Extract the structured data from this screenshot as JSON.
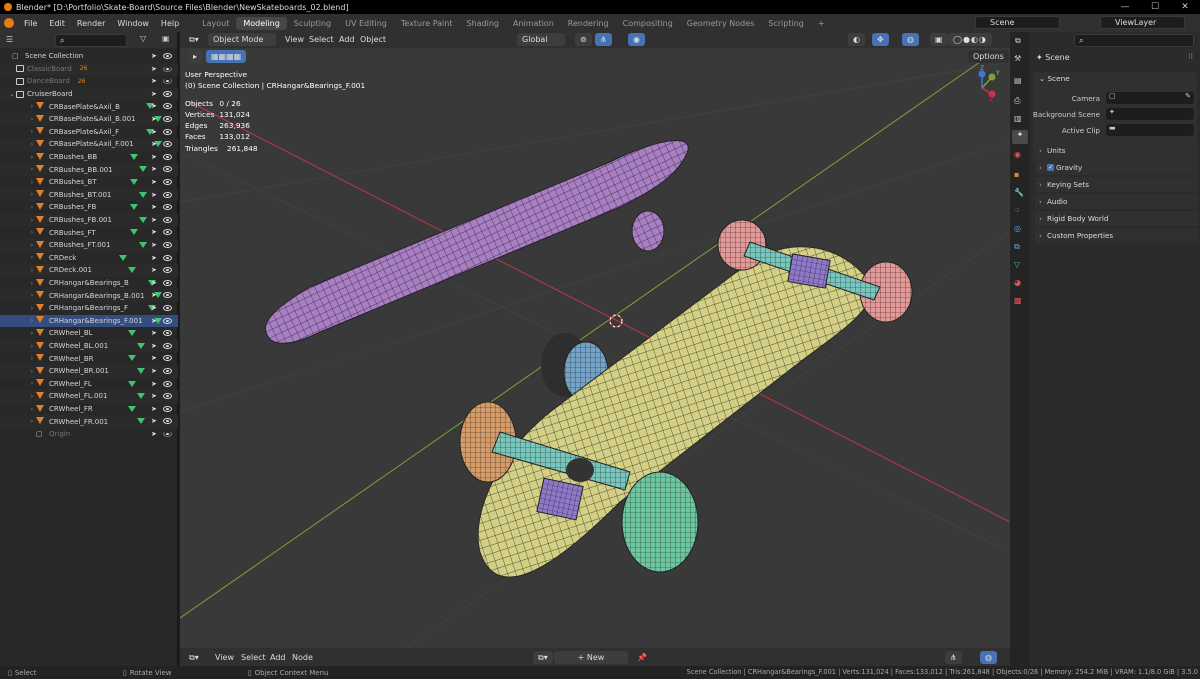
{
  "window": {
    "title": "Blender* [D:\\Portfolio\\Skate-Board\\Source Files\\Blender\\NewSkateboards_02.blend]",
    "min": "—",
    "max": "☐",
    "close": "✕"
  },
  "menus": [
    "File",
    "Edit",
    "Render",
    "Window",
    "Help"
  ],
  "workspaces": [
    "Layout",
    "Modeling",
    "Sculpting",
    "UV Editing",
    "Texture Paint",
    "Shading",
    "Animation",
    "Rendering",
    "Compositing",
    "Geometry Nodes",
    "Scripting",
    "+"
  ],
  "active_workspace": "Modeling",
  "scene_field": "Scene",
  "viewlayer_field": "ViewLayer",
  "outliner": {
    "root": "Scene Collection",
    "collections": [
      {
        "name": "ClassicBoard",
        "badge": "26",
        "dim": true
      },
      {
        "name": "DanceBoard",
        "badge": "26",
        "dim": true
      },
      {
        "name": "CruiserBoard",
        "dim": false
      }
    ],
    "objects": [
      "CRBasePlate&Axil_B",
      "CRBasePlate&Axil_B.001",
      "CRBasePlate&Axil_F",
      "CRBasePlate&Axil_F.001",
      "CRBushes_BB",
      "CRBushes_BB.001",
      "CRBushes_BT",
      "CRBushes_BT.001",
      "CRBushes_FB",
      "CRBushes_FB.001",
      "CRBushes_FT",
      "CRBushes_FT.001",
      "CRDeck",
      "CRDeck.001",
      "CRHangar&Bearings_B",
      "CRHangar&Bearings_B.001",
      "CRHangar&Bearings_F",
      "CRHangar&Bearings_F.001",
      "CRWheel_BL",
      "CRWheel_BL.001",
      "CRWheel_BR",
      "CRWheel_BR.001",
      "CRWheel_FL",
      "CRWheel_FL.001",
      "CRWheel_FR",
      "CRWheel_FR.001"
    ],
    "selected": "CRHangar&Bearings_F.001",
    "footer_item": "Origin"
  },
  "viewport": {
    "mode": "Object Mode",
    "menus": [
      "View",
      "Select",
      "Add",
      "Object"
    ],
    "orientation": "Global",
    "options": "Options",
    "perspective": "User Perspective",
    "context": "(0) Scene Collection | CRHangar&Bearings_F.001",
    "stats": [
      {
        "k": "Objects",
        "v": "0 / 26"
      },
      {
        "k": "Vertices",
        "v": "131,024"
      },
      {
        "k": "Edges",
        "v": "263,936"
      },
      {
        "k": "Faces",
        "v": "133,012"
      },
      {
        "k": "Triangles",
        "v": "261,848"
      }
    ],
    "gizmo": {
      "x": "X",
      "y": "Y",
      "z": "Z"
    },
    "footer_menus": [
      "View",
      "Select",
      "Add",
      "Node"
    ],
    "new_button": "New"
  },
  "properties": {
    "title": "Scene",
    "section": "Scene",
    "camera_label": "Camera",
    "bg_scene_label": "Background Scene",
    "active_clip_label": "Active Clip",
    "panels": [
      "Units",
      "Gravity",
      "Keying Sets",
      "Audio",
      "Rigid Body World",
      "Custom Properties"
    ]
  },
  "status": {
    "select": "Select",
    "rotate": "Rotate View",
    "context_menu": "Object Context Menu",
    "info": "Scene Collection | CRHangar&Bearings_F.001 | Verts:131,024 | Faces:133,012 | Tris:261,848 | Objects:0/26 | Memory: 254.2 MiB | VRAM: 1.1/8.0 GiB | 3.5.0"
  },
  "colors": {
    "accent": "#4772b3",
    "orange_obj": "#e0802a",
    "green_mesh": "#3fc46f",
    "x_axis": "#c4344a",
    "y_axis": "#7ea23a"
  }
}
